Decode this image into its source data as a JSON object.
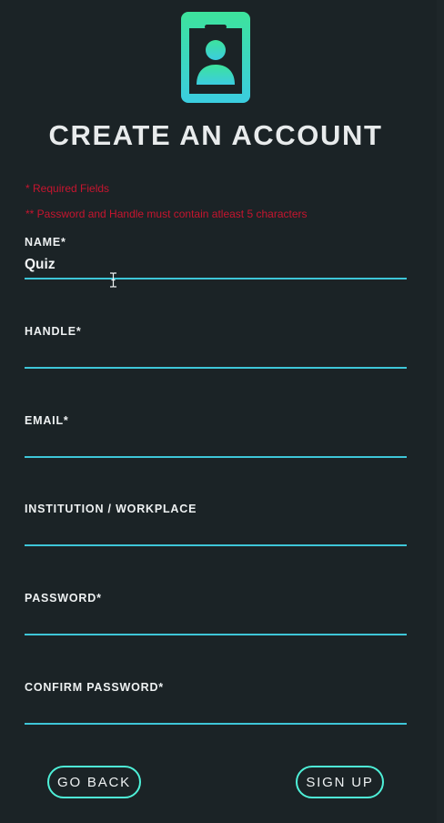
{
  "header": {
    "logo_icon": "id-badge-icon",
    "title": "CREATE AN ACCOUNT"
  },
  "notes": {
    "required": "* Required Fields",
    "password_rule": "** Password and Handle must contain atleast 5 characters"
  },
  "form": {
    "fields": [
      {
        "label": "NAME*",
        "value": "Quiz",
        "placeholder": ""
      },
      {
        "label": "HANDLE*",
        "value": "",
        "placeholder": ""
      },
      {
        "label": "EMAIL*",
        "value": "",
        "placeholder": ""
      },
      {
        "label": "INSTITUTION / WORKPLACE",
        "value": "",
        "placeholder": ""
      },
      {
        "label": "PASSWORD*",
        "value": "",
        "placeholder": ""
      },
      {
        "label": "CONFIRM PASSWORD*",
        "value": "",
        "placeholder": ""
      }
    ]
  },
  "actions": {
    "back_label": "GO BACK",
    "signup_label": "SIGN UP"
  },
  "colors": {
    "background": "#1b2326",
    "accent": "#3ec6d8",
    "button_border": "#4ef0d8",
    "logo_gradient_top": "#3de39c",
    "logo_gradient_bottom": "#3bcde0",
    "notice_red": "#c7152f"
  }
}
